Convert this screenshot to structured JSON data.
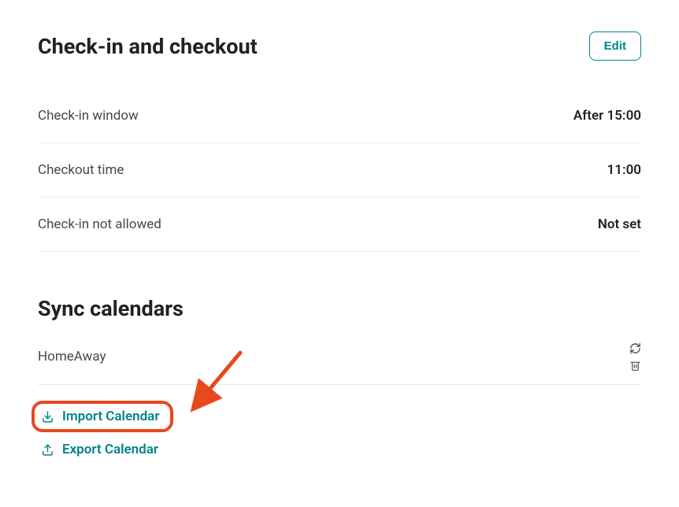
{
  "checkinSection": {
    "title": "Check-in and checkout",
    "editLabel": "Edit",
    "rows": [
      {
        "label": "Check-in window",
        "value": "After 15:00"
      },
      {
        "label": "Checkout time",
        "value": "11:00"
      },
      {
        "label": "Check-in not allowed",
        "value": "Not set"
      }
    ]
  },
  "syncSection": {
    "title": "Sync calendars",
    "providerName": "HomeAway",
    "importLabel": "Import Calendar",
    "exportLabel": "Export Calendar"
  },
  "colors": {
    "accent": "#008489",
    "highlight": "#e8481e"
  }
}
